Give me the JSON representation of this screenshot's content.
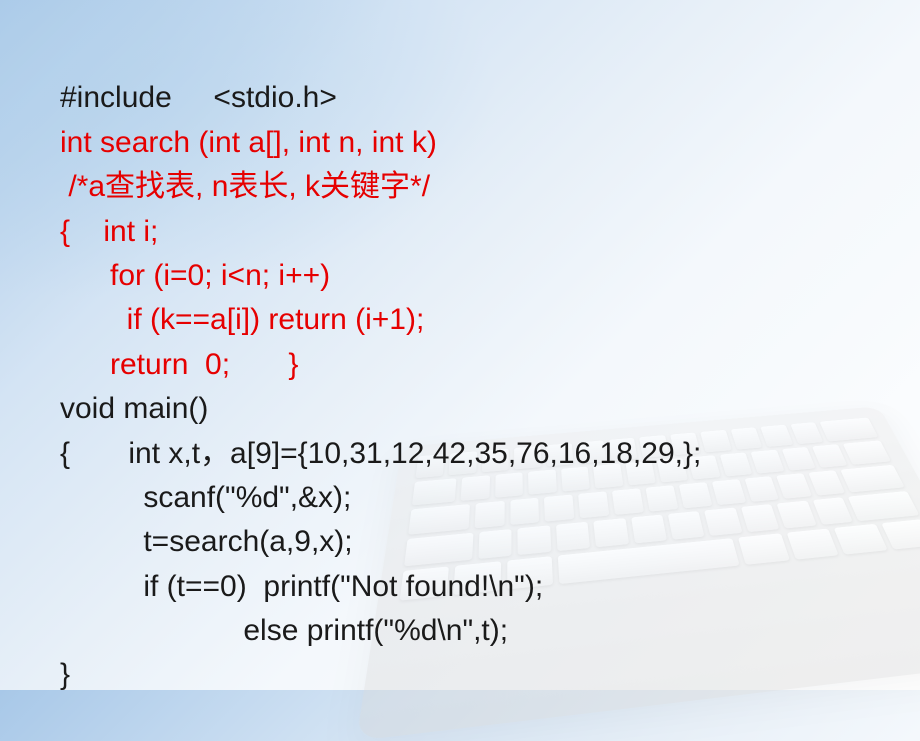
{
  "code": {
    "line1": "#include     <stdio.h>",
    "line2": "int search (int a[], int n, int k)",
    "line3": " /*a查找表, n表长, k关键字*/",
    "line4": "{    int i;",
    "line5": "      for (i=0; i<n; i++)",
    "line6": "        if (k==a[i]) return (i+1);",
    "line7": "      return  0;       }",
    "line8": "void main()",
    "line9": "{       int x,t，a[9]={10,31,12,42,35,76,16,18,29,};",
    "line10": "          scanf(\"%d\",&x);",
    "line11": "          t=search(a,9,x);",
    "line12": "          if (t==0)  printf(\"Not found!\\n\");",
    "line13": "                      else printf(\"%d\\n\",t);",
    "line14": "}"
  }
}
